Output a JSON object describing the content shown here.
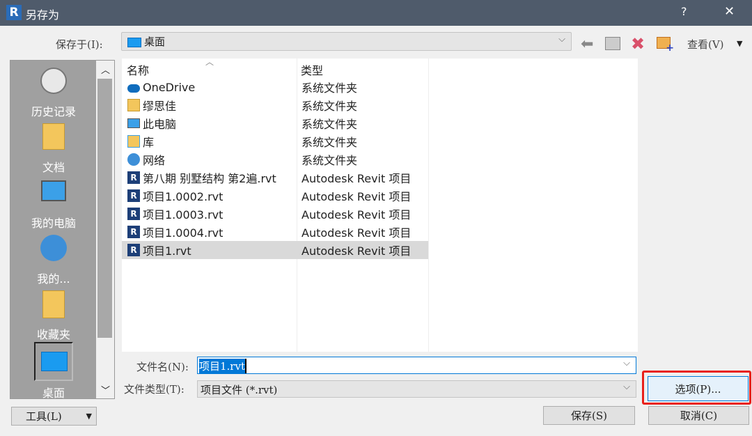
{
  "window": {
    "title": "另存为",
    "help": "?",
    "close": "✕"
  },
  "save_in": {
    "label": "保存于(I):",
    "value": "桌面"
  },
  "toolbar": {
    "view_label": "查看(V)"
  },
  "sidebar": {
    "items": [
      {
        "label": "历史记录",
        "icon": "history-icon"
      },
      {
        "label": "文档",
        "icon": "documents-icon"
      },
      {
        "label": "我的电脑",
        "icon": "computer-icon"
      },
      {
        "label": "我的...",
        "icon": "network-icon"
      },
      {
        "label": "收藏夹",
        "icon": "favorites-icon"
      },
      {
        "label": "桌面",
        "icon": "desktop-icon"
      }
    ]
  },
  "list": {
    "columns": {
      "name": "名称",
      "type": "类型"
    },
    "rows": [
      {
        "name": "OneDrive",
        "type": "系统文件夹",
        "icon": "onedrive-icon"
      },
      {
        "name": "缪思佳",
        "type": "系统文件夹",
        "icon": "user-folder-icon"
      },
      {
        "name": "此电脑",
        "type": "系统文件夹",
        "icon": "computer-icon"
      },
      {
        "name": "库",
        "type": "系统文件夹",
        "icon": "library-icon"
      },
      {
        "name": "网络",
        "type": "系统文件夹",
        "icon": "network-icon"
      },
      {
        "name": "第八期 别墅结构 第2遍.rvt",
        "type": "Autodesk Revit 项目",
        "icon": "revit-file-icon"
      },
      {
        "name": "项目1.0002.rvt",
        "type": "Autodesk Revit 项目",
        "icon": "revit-file-icon"
      },
      {
        "name": "项目1.0003.rvt",
        "type": "Autodesk Revit 项目",
        "icon": "revit-file-icon"
      },
      {
        "name": "项目1.0004.rvt",
        "type": "Autodesk Revit 项目",
        "icon": "revit-file-icon"
      },
      {
        "name": "项目1.rvt",
        "type": "Autodesk Revit 项目",
        "icon": "revit-file-icon",
        "selected": true
      }
    ]
  },
  "filename": {
    "label": "文件名(N):",
    "value": "项目1.rvt"
  },
  "filetype": {
    "label": "文件类型(T):",
    "value": "项目文件 (*.rvt)"
  },
  "buttons": {
    "options": "选项(P)...",
    "tools": "工具(L)",
    "save": "保存(S)",
    "cancel": "取消(C)"
  },
  "colors": {
    "titlebar": "#4f5b6b",
    "selection": "#0078d7",
    "highlight_box": "#e8201a"
  }
}
